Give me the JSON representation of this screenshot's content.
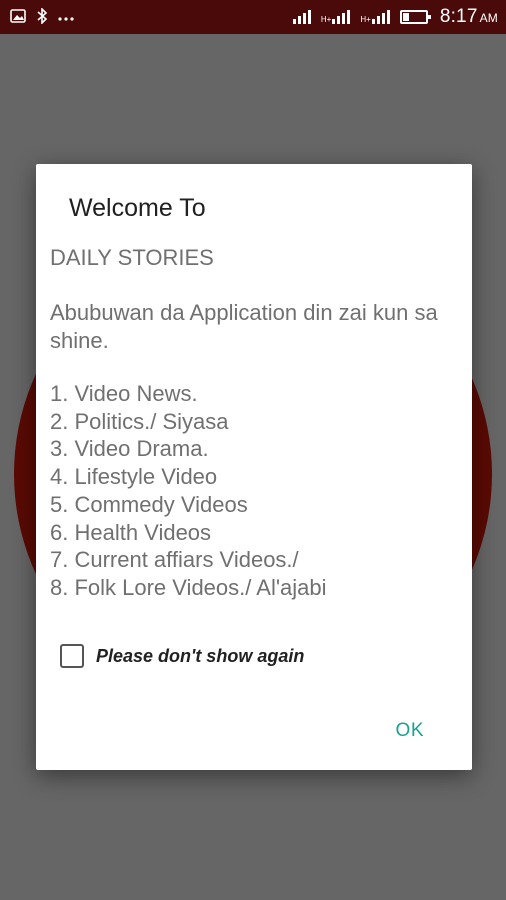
{
  "status_bar": {
    "left_icons": [
      "image-icon",
      "bluetooth-icon",
      "more-icon"
    ],
    "network_label_1": "H+",
    "network_label_2": "H+",
    "time": "8:17",
    "ampm": "AM"
  },
  "dialog": {
    "title": "Welcome To",
    "heading": "DAILY STORIES",
    "intro": "Abubuwan da Application din zai kun sa shine.",
    "features": [
      "1. Video News.",
      "2. Politics./ Siyasa",
      "3. Video Drama.",
      "4. Lifestyle Video",
      "5. Commedy Videos",
      "6. Health Videos",
      "7. Current affiars Videos./",
      "8. Folk Lore Videos./ Al'ajabi"
    ],
    "checkbox_label": "Please don't show again",
    "checkbox_checked": false,
    "ok_label": "OK"
  },
  "colors": {
    "status_bar": "#4a0a0a",
    "scrim": "#666666",
    "accent": "#1aa38f"
  }
}
